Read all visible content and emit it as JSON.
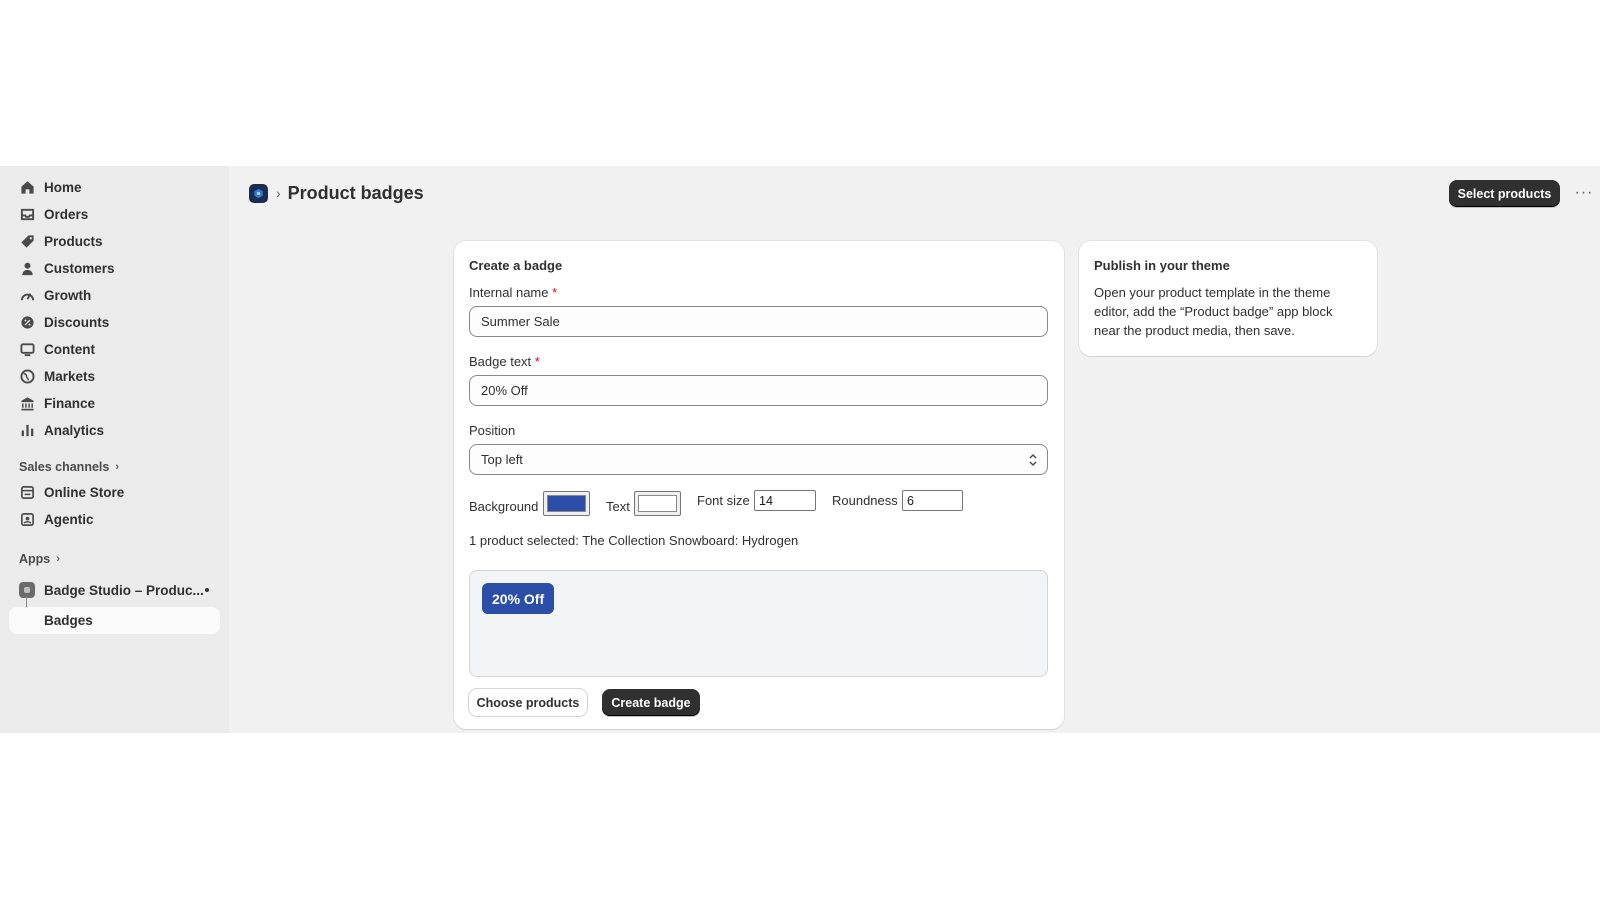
{
  "sidebar": {
    "items": [
      {
        "label": "Home",
        "icon": "home-icon"
      },
      {
        "label": "Orders",
        "icon": "inbox-icon"
      },
      {
        "label": "Products",
        "icon": "tag-icon"
      },
      {
        "label": "Customers",
        "icon": "person-icon"
      },
      {
        "label": "Growth",
        "icon": "gauge-icon"
      },
      {
        "label": "Discounts",
        "icon": "discount-icon"
      },
      {
        "label": "Content",
        "icon": "monitor-icon"
      },
      {
        "label": "Markets",
        "icon": "globe-icon"
      },
      {
        "label": "Finance",
        "icon": "bank-icon"
      },
      {
        "label": "Analytics",
        "icon": "bar-chart-icon"
      }
    ],
    "sales_channels_label": "Sales channels",
    "channels": [
      {
        "label": "Online Store",
        "icon": "store-icon"
      },
      {
        "label": "Agentic",
        "icon": "agentic-icon"
      }
    ],
    "apps_label": "Apps",
    "app_name": "Badge Studio – Produc...",
    "app_subitem": "Badges"
  },
  "header": {
    "breadcrumb_sep": "›",
    "title": "Product badges",
    "select_products_label": "Select products",
    "more_label": "···"
  },
  "form": {
    "card_title": "Create a badge",
    "internal_name_label": "Internal name",
    "internal_name_value": "Summer Sale",
    "badge_text_label": "Badge text",
    "badge_text_value": "20% Off",
    "required_mark": "*",
    "position_label": "Position",
    "position_value": "Top left",
    "background_label": "Background",
    "background_color": "#2b4ea8",
    "text_label": "Text",
    "text_color": "#ffffff",
    "font_size_label": "Font size",
    "font_size_value": "14",
    "roundness_label": "Roundness",
    "roundness_value": "6",
    "selected_text": "1 product selected: The Collection Snowboard: Hydrogen",
    "preview_badge_text": "20% Off",
    "choose_products_label": "Choose products",
    "create_badge_label": "Create badge"
  },
  "side_card": {
    "title": "Publish in your theme",
    "body": "Open your product template in the theme editor, add the “Product badge” app block near the product media, then save."
  },
  "colors": {
    "primary_button": "#303030",
    "badge_background": "#2b4ea8",
    "badge_text": "#ffffff"
  }
}
